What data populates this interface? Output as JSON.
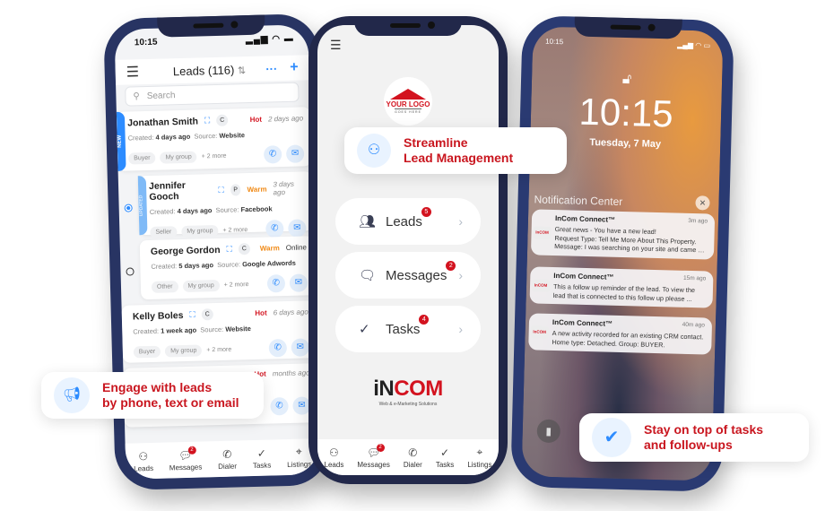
{
  "left_phone": {
    "status_time": "10:15",
    "header": {
      "title": "Leads (116)",
      "sort_icon": "⇅",
      "more_label": "···",
      "add_label": "+"
    },
    "search": {
      "placeholder": "Search"
    },
    "leads": [
      {
        "name": "Jonathan Smith",
        "type": "C",
        "temperature": "Hot",
        "temp_color": "#d3131f",
        "when": "2 days ago",
        "created": "4 days ago",
        "source": "Website",
        "chips": [
          "Buyer",
          "My group"
        ],
        "more": "+ 2 more",
        "flag": "NEW"
      },
      {
        "name": "Jennifer Gooch",
        "type": "P",
        "temperature": "Warm",
        "temp_color": "#f08a17",
        "when": "3 days ago",
        "created": "4 days ago",
        "source": "Facebook",
        "chips": [
          "Seller",
          "My group"
        ],
        "more": "+ 2 more",
        "flag": "UPDATED"
      },
      {
        "name": "George Gordon",
        "type": "C",
        "temperature": "Warm",
        "temp_color": "#f08a17",
        "when": "Online",
        "created": "5 days ago",
        "source": "Google Adwords",
        "chips": [
          "Other",
          "My group"
        ],
        "more": "+ 2 more",
        "flag": ""
      },
      {
        "name": "Kelly Boles",
        "type": "C",
        "temperature": "Hot",
        "temp_color": "#d3131f",
        "when": "6 days ago",
        "created": "1 week ago",
        "source": "Website",
        "chips": [
          "Buyer",
          "My group"
        ],
        "more": "+ 2 more",
        "flag": ""
      },
      {
        "name": "",
        "type": "",
        "temperature": "Hot",
        "temp_color": "#d3131f",
        "when": "months ago",
        "created": "",
        "source": "",
        "chips": [],
        "more": "",
        "flag": ""
      }
    ],
    "labels": {
      "created": "Created:",
      "source": "Source:"
    },
    "tabbar": [
      {
        "label": "Leads",
        "icon": "people-icon",
        "badge": ""
      },
      {
        "label": "Messages",
        "icon": "chat-icon",
        "badge": "2"
      },
      {
        "label": "Dialer",
        "icon": "phone-icon",
        "badge": ""
      },
      {
        "label": "Tasks",
        "icon": "check-icon",
        "badge": ""
      },
      {
        "label": "Listings",
        "icon": "location-icon",
        "badge": ""
      }
    ]
  },
  "center_phone": {
    "logo": {
      "text": "YOUR LOGO",
      "sub": "GOES HERE"
    },
    "menu": [
      {
        "label": "Leads",
        "icon": "people-icon",
        "badge": "5"
      },
      {
        "label": "Messages",
        "icon": "chat-bubble-icon",
        "badge": "2"
      },
      {
        "label": "Tasks",
        "icon": "check-circle-icon",
        "badge": "4"
      }
    ],
    "brand": {
      "i": "i",
      "name_dark": "N",
      "name_red": "COM",
      "tagline": "Web & e-Marketing Solutions"
    },
    "tabbar": [
      {
        "label": "Leads",
        "badge": ""
      },
      {
        "label": "Messages",
        "badge": "2"
      },
      {
        "label": "Dialer",
        "badge": ""
      },
      {
        "label": "Tasks",
        "badge": ""
      },
      {
        "label": "Listings",
        "badge": ""
      }
    ]
  },
  "right_phone": {
    "status_time": "10:15",
    "time": "10:15",
    "date": "Tuesday, 7 May",
    "notification_center_title": "Notification Center",
    "notifications": [
      {
        "app": "InCom Connect™",
        "ago": "3m ago",
        "lines": [
          "Great news - You have a new lead!",
          "Request Type: Tell Me More About This Property.",
          "Message: I was searching on your site and came acc..."
        ]
      },
      {
        "app": "InCom Connect™",
        "ago": "15m ago",
        "lines": [
          "This a follow up reminder of the lead. To view the",
          "lead that is connected to this follow up please ..."
        ]
      },
      {
        "app": "InCom Connect™",
        "ago": "40m ago",
        "lines": [
          "A new activity recorded for an existing CRM contact.",
          "Home type: Detached. Group: BUYER."
        ]
      }
    ],
    "notif_logo": "InCOM"
  },
  "callouts": {
    "lead_management": [
      "Streamline",
      "Lead Management"
    ],
    "engage": [
      "Engage with leads",
      "by phone, text or email"
    ],
    "tasks": [
      "Stay on top of tasks",
      "and follow-ups"
    ]
  },
  "colors": {
    "brand_red": "#c9161f",
    "accent_blue": "#2d8cff",
    "frame": "#22284a"
  }
}
